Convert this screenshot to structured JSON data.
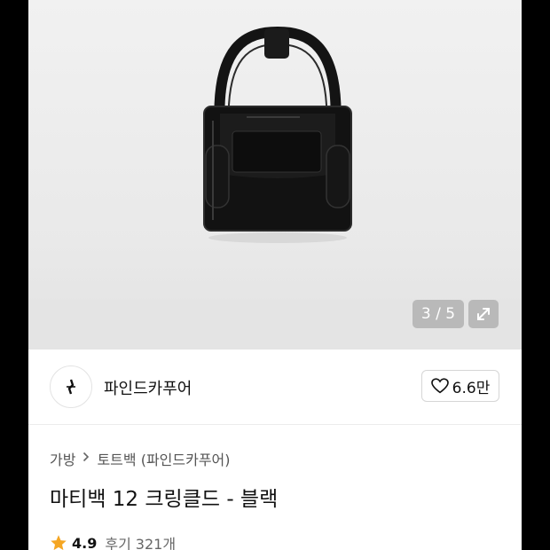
{
  "gallery": {
    "counter": "3 / 5"
  },
  "store": {
    "name": "파인드카푸어",
    "like_count": "6.6만"
  },
  "breadcrumb": {
    "category": "가방",
    "subcategory": "토트백 (파인드카푸어)"
  },
  "product": {
    "title": "마티백 12 크링클드 - 블랙"
  },
  "rating": {
    "value": "4.9",
    "review_label": "후기",
    "review_count": "321개"
  },
  "icons": {
    "expand": "expand-icon",
    "heart": "heart-icon",
    "chevron": "chevron-right-icon",
    "star": "star-icon"
  },
  "colors": {
    "star": "#f5a623",
    "bag": "#111111"
  }
}
